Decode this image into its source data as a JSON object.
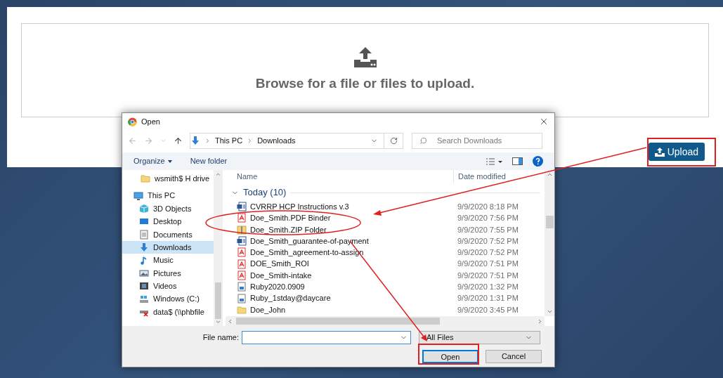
{
  "dropzone": {
    "message": "Browse for a file or files to upload."
  },
  "upload_button": {
    "label": "Upload"
  },
  "dialog": {
    "title": "Open",
    "breadcrumb": [
      "This PC",
      "Downloads"
    ],
    "search": {
      "placeholder": "Search Downloads"
    },
    "toolbar": {
      "organize": "Organize",
      "new_folder": "New folder"
    },
    "sidebar": [
      {
        "label": "wsmith$ H drive",
        "kind": "folder",
        "selected": false
      },
      {
        "label": "This PC",
        "kind": "pc",
        "selected": false,
        "children": [
          {
            "label": "3D Objects",
            "kind": "cube",
            "selected": false
          },
          {
            "label": "Desktop",
            "kind": "desktop",
            "selected": false
          },
          {
            "label": "Documents",
            "kind": "document",
            "selected": false
          },
          {
            "label": "Downloads",
            "kind": "download",
            "selected": true
          },
          {
            "label": "Music",
            "kind": "music",
            "selected": false
          },
          {
            "label": "Pictures",
            "kind": "pictures",
            "selected": false
          },
          {
            "label": "Videos",
            "kind": "videos",
            "selected": false
          },
          {
            "label": "Windows (C:)",
            "kind": "drive",
            "selected": false
          },
          {
            "label": "data$ (\\\\phbfile",
            "kind": "netdrive",
            "selected": false
          }
        ]
      }
    ],
    "columns": [
      "Name",
      "Date modified"
    ],
    "group": "Today (10)",
    "files": [
      {
        "name": "CVRRP HCP Instructions v.3",
        "kind": "word",
        "date": "9/9/2020 8:18 PM"
      },
      {
        "name": "Doe_Smith.PDF Binder",
        "kind": "pdf",
        "date": "9/9/2020 7:56 PM"
      },
      {
        "name": "Doe_Smith.ZIP Folder",
        "kind": "zip",
        "date": "9/9/2020 7:55 PM"
      },
      {
        "name": "Doe_Smith_guarantee-of-payment",
        "kind": "word",
        "date": "9/9/2020 7:52 PM"
      },
      {
        "name": "Doe_Smith_agreement-to-assign",
        "kind": "pdf",
        "date": "9/9/2020 7:52 PM"
      },
      {
        "name": "DOE_Smith_ROI",
        "kind": "pdf",
        "date": "9/9/2020 7:51 PM"
      },
      {
        "name": "Doe_Smith-intake",
        "kind": "pdf",
        "date": "9/9/2020 7:51 PM"
      },
      {
        "name": "Ruby2020.0909",
        "kind": "image",
        "date": "9/9/2020 1:32 PM"
      },
      {
        "name": "Ruby_1stday@daycare",
        "kind": "image",
        "date": "9/9/2020 1:31 PM"
      },
      {
        "name": "Doe_John",
        "kind": "folder",
        "date": "9/9/2020 3:45 PM"
      }
    ],
    "file_name_label": "File name:",
    "filter": "All Files",
    "buttons": [
      {
        "label": "Open",
        "kind": "primary"
      },
      {
        "label": "Cancel",
        "kind": "secondary"
      }
    ]
  }
}
